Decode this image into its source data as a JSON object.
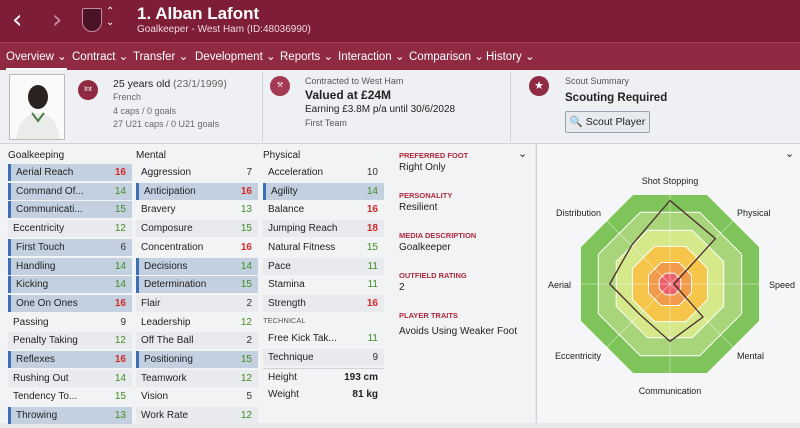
{
  "header": {
    "player_name": "1. Alban Lafont",
    "subtitle": "Goalkeeper - West Ham (ID:48036990)"
  },
  "nav": [
    "Overview ⌄",
    "Contract ⌄",
    "Transfer ⌄",
    "Development ⌄",
    "Reports ⌄",
    "Interaction ⌄",
    "Comparison ⌄",
    "History ⌄"
  ],
  "info": {
    "intl_badge": "Int",
    "age": "25 years old",
    "dob": "(23/1/1999)",
    "nationality": "French",
    "caps": "4 caps / 0 goals",
    "u21_caps": "27 U21 caps / 0 U21 goals",
    "contract_label": "Contracted to West Ham",
    "value": "Valued at £24M",
    "earning": "Earning £3.8M p/a until 30/6/2028",
    "squad": "First Team",
    "scout_label": "Scout Summary",
    "scout_status": "Scouting Required",
    "scout_button": "Scout Player"
  },
  "goalkeeping": {
    "title": "Goalkeeping",
    "rows": [
      {
        "label": "Aerial Reach",
        "value": "16"
      },
      {
        "label": "Command Of...",
        "value": "14"
      },
      {
        "label": "Communicati...",
        "value": "15"
      },
      {
        "label": "Eccentricity",
        "value": "12"
      },
      {
        "label": "First Touch",
        "value": "6"
      },
      {
        "label": "Handling",
        "value": "14"
      },
      {
        "label": "Kicking",
        "value": "14"
      },
      {
        "label": "One On Ones",
        "value": "16"
      },
      {
        "label": "Passing",
        "value": "9"
      },
      {
        "label": "Penalty Taking",
        "value": "12"
      },
      {
        "label": "Reflexes",
        "value": "16"
      },
      {
        "label": "Rushing Out",
        "value": "14"
      },
      {
        "label": "Tendency To...",
        "value": "15"
      },
      {
        "label": "Throwing",
        "value": "13"
      }
    ]
  },
  "mental": {
    "title": "Mental",
    "rows": [
      {
        "label": "Aggression",
        "value": "7"
      },
      {
        "label": "Anticipation",
        "value": "16"
      },
      {
        "label": "Bravery",
        "value": "13"
      },
      {
        "label": "Composure",
        "value": "15"
      },
      {
        "label": "Concentration",
        "value": "16"
      },
      {
        "label": "Decisions",
        "value": "14"
      },
      {
        "label": "Determination",
        "value": "15"
      },
      {
        "label": "Flair",
        "value": "2"
      },
      {
        "label": "Leadership",
        "value": "12"
      },
      {
        "label": "Off The Ball",
        "value": "2"
      },
      {
        "label": "Positioning",
        "value": "15"
      },
      {
        "label": "Teamwork",
        "value": "12"
      },
      {
        "label": "Vision",
        "value": "5"
      },
      {
        "label": "Work Rate",
        "value": "12"
      }
    ]
  },
  "physical": {
    "title": "Physical",
    "rows": [
      {
        "label": "Acceleration",
        "value": "10"
      },
      {
        "label": "Agility",
        "value": "14"
      },
      {
        "label": "Balance",
        "value": "16"
      },
      {
        "label": "Jumping Reach",
        "value": "18"
      },
      {
        "label": "Natural Fitness",
        "value": "15"
      },
      {
        "label": "Pace",
        "value": "11"
      },
      {
        "label": "Stamina",
        "value": "11"
      },
      {
        "label": "Strength",
        "value": "16"
      }
    ],
    "technical_label": "TECHNICAL",
    "technical_rows": [
      {
        "label": "Free Kick Tak...",
        "value": "11"
      },
      {
        "label": "Technique",
        "value": "9"
      }
    ],
    "height_label": "Height",
    "height": "193 cm",
    "weight_label": "Weight",
    "weight": "81 kg"
  },
  "details": {
    "preferred_foot_label": "PREFERRED FOOT",
    "preferred_foot": "Right Only",
    "personality_label": "PERSONALITY",
    "personality": "Resilient",
    "media_label": "MEDIA DESCRIPTION",
    "media": "Goalkeeper",
    "outfield_label": "OUTFIELD RATING",
    "outfield": "2",
    "traits_label": "PLAYER TRAITS",
    "traits": "Avoids Using Weaker Foot"
  },
  "radar": {
    "axes": [
      "Shot Stopping",
      "Physical",
      "Speed",
      "Mental",
      "Communication",
      "Eccentricity",
      "Aerial",
      "Distribution"
    ]
  },
  "colors": {
    "topbar": "#7d1e36",
    "navbar": "#8f2a42",
    "red": "#d62828",
    "green": "#3d8f1f",
    "highlight": "#c3d0e0"
  }
}
